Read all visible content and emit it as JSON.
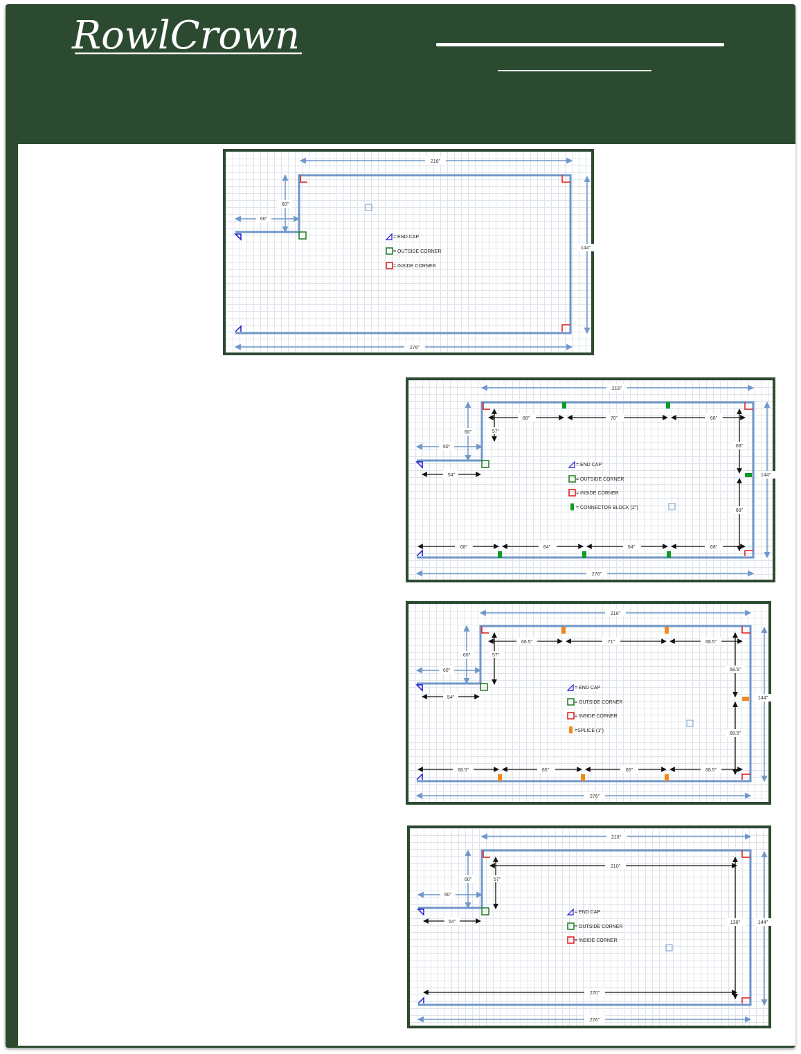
{
  "brand": {
    "name": "RowlCrown",
    "text_color": "#ffffff",
    "frame_color": "#2c4a2f"
  },
  "legend": {
    "end_cap": "= END CAP",
    "outside_corner": "= OUTSIDE CORNER",
    "inside_corner": "= INSIDE CORNER",
    "connector_block": "= CONNECTOR BLOCK (2\")",
    "splice": "=SPLICE (1\")"
  },
  "colors": {
    "molding": "#6f97c9",
    "end_cap": "#1a1ad0",
    "outside_corner": "#1d7a1d",
    "inside_corner": "#e01818",
    "connector_block": "#119a2a",
    "splice": "#f08a1f",
    "arrow": "#111111"
  },
  "diagrams": [
    {
      "name": "overview",
      "dims": {
        "top": "216\"",
        "right": "144\"",
        "bottom": "276\"",
        "jog_vertical": "60\"",
        "jog_horizontal": "60\""
      }
    },
    {
      "name": "connector-block-layout",
      "dims": {
        "top": "216\"",
        "right": "144\"",
        "bottom": "276\"",
        "jog_vertical": "60\"",
        "jog_horizontal": "60\"",
        "inner_vertical": "57\"",
        "inner_horizontal": "54\"",
        "top_segments": [
          "68\"",
          "70\"",
          "68\""
        ],
        "right_segments": [
          "68\"",
          "68\""
        ],
        "bottom_segments": [
          "68\"",
          "64\"",
          "64\"",
          "68\""
        ]
      }
    },
    {
      "name": "splice-layout",
      "dims": {
        "top": "216\"",
        "right": "144\"",
        "bottom": "276\"",
        "jog_vertical": "60\"",
        "jog_horizontal": "60\"",
        "inner_vertical": "57\"",
        "inner_horizontal": "54\"",
        "top_segments": [
          "68.5\"",
          "71\"",
          "68.5\""
        ],
        "right_segments": [
          "68.5\"",
          "68.5\""
        ],
        "bottom_segments": [
          "68.5\"",
          "65\"",
          "65\"",
          "68.5\""
        ]
      }
    },
    {
      "name": "inner-dimensions",
      "dims": {
        "top": "216\"",
        "right": "144\"",
        "bottom": "276\"",
        "jog_vertical": "60\"",
        "jog_horizontal": "60\"",
        "inner_vertical": "57\"",
        "inner_horizontal": "54\"",
        "inner_top": "210\"",
        "inner_right": "138\"",
        "inner_bottom": "270\""
      }
    }
  ]
}
